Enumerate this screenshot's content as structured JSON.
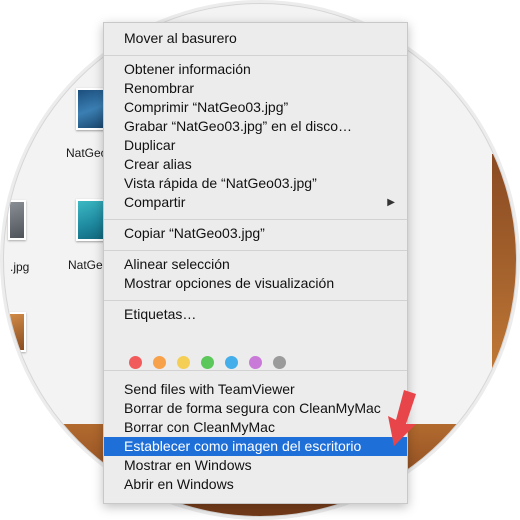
{
  "desktop": {
    "icons": [
      {
        "label": "NatGeo"
      },
      {
        "label": "NatGeo"
      },
      {
        "label": ".jpg"
      }
    ]
  },
  "context_menu": {
    "items": [
      {
        "label": "Mover al basurero"
      },
      {
        "label": "Obtener información"
      },
      {
        "label": "Renombrar"
      },
      {
        "label": "Comprimir “NatGeo03.jpg”"
      },
      {
        "label": "Grabar “NatGeo03.jpg” en el disco…"
      },
      {
        "label": "Duplicar"
      },
      {
        "label": "Crear alias"
      },
      {
        "label": "Vista rápida de “NatGeo03.jpg”"
      },
      {
        "label": "Compartir"
      },
      {
        "label": "Copiar “NatGeo03.jpg”"
      },
      {
        "label": "Alinear selección"
      },
      {
        "label": "Mostrar opciones de visualización"
      },
      {
        "label": "Etiquetas…"
      },
      {
        "label": "Send files with TeamViewer"
      },
      {
        "label": "Borrar de forma segura con CleanMyMac"
      },
      {
        "label": "Borrar con CleanMyMac"
      },
      {
        "label": "Establecer como imagen del escritorio"
      },
      {
        "label": "Mostrar en Windows"
      },
      {
        "label": "Abrir en Windows"
      }
    ],
    "selected_label": "Establecer como imagen del escritorio",
    "submenu_arrow": "▶",
    "tag_colors": [
      "#f25b5b",
      "#f7a14a",
      "#f5cf55",
      "#5cc75a",
      "#43aee9",
      "#c97ad8",
      "#9b9b9b"
    ],
    "selection_color": "#1f6fd9",
    "annotation_arrow_color": "#e8454a"
  }
}
